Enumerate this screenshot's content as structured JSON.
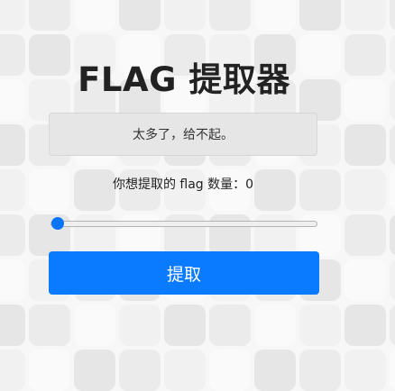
{
  "page": {
    "title": "FLAG 提取器"
  },
  "message": {
    "text": "太多了，给不起。"
  },
  "amount": {
    "label": "你想提取的 flag 数量：0",
    "value": 0,
    "fraction": 0
  },
  "actions": {
    "extract_label": "提取"
  },
  "colors": {
    "accent": "#0a7bff",
    "message_bg": "#e6e6e6",
    "title": "#222222"
  }
}
